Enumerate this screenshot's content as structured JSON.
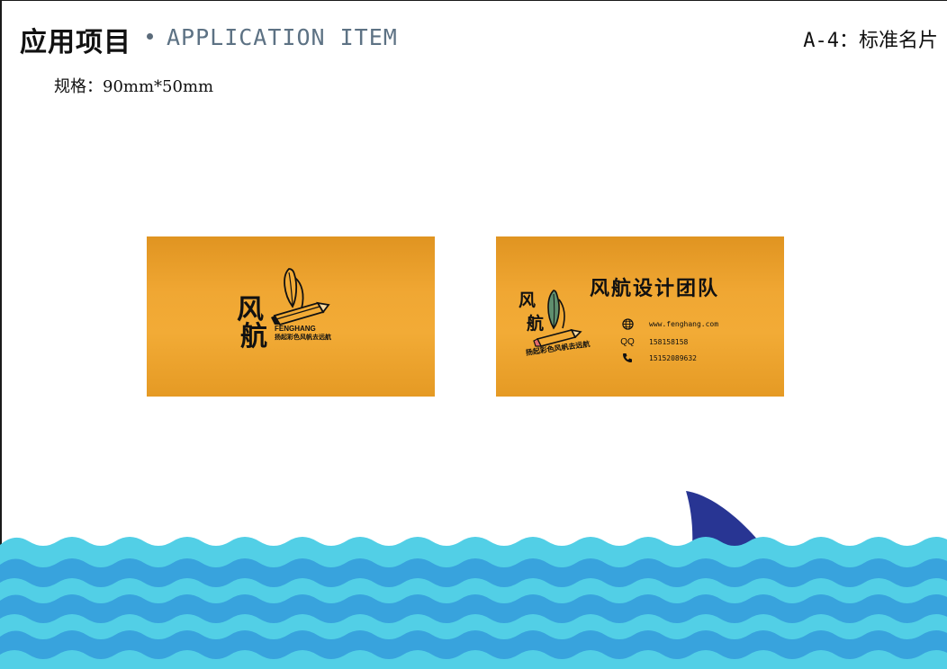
{
  "header": {
    "title_zh": "应用项目",
    "title_en": "APPLICATION ITEM",
    "page_code": "A-4：标准名片"
  },
  "spec": {
    "text": "规格：90mm*50mm"
  },
  "front_card": {
    "logo_char_1": "风",
    "logo_char_2": "航",
    "brand_en": "FENGHANG",
    "slogan": "扬起彩色风帆去远航"
  },
  "back_card": {
    "logo_char_1": "风",
    "logo_char_2": "航",
    "slogan": "扬起彩色风帆去远航",
    "team_name": "风航设计团队",
    "contacts": {
      "website": "www.fenghang.com",
      "qq_label": "QQ",
      "qq": "158158158",
      "phone": "15152089632"
    }
  },
  "icons": [
    "pencil-brush-icon",
    "globe-icon",
    "phone-icon"
  ],
  "colors": {
    "card_orange": "#f0a733",
    "sea_light": "#52cfe6",
    "sea_dark": "#38a3dd",
    "shark_fin": "#283593"
  }
}
